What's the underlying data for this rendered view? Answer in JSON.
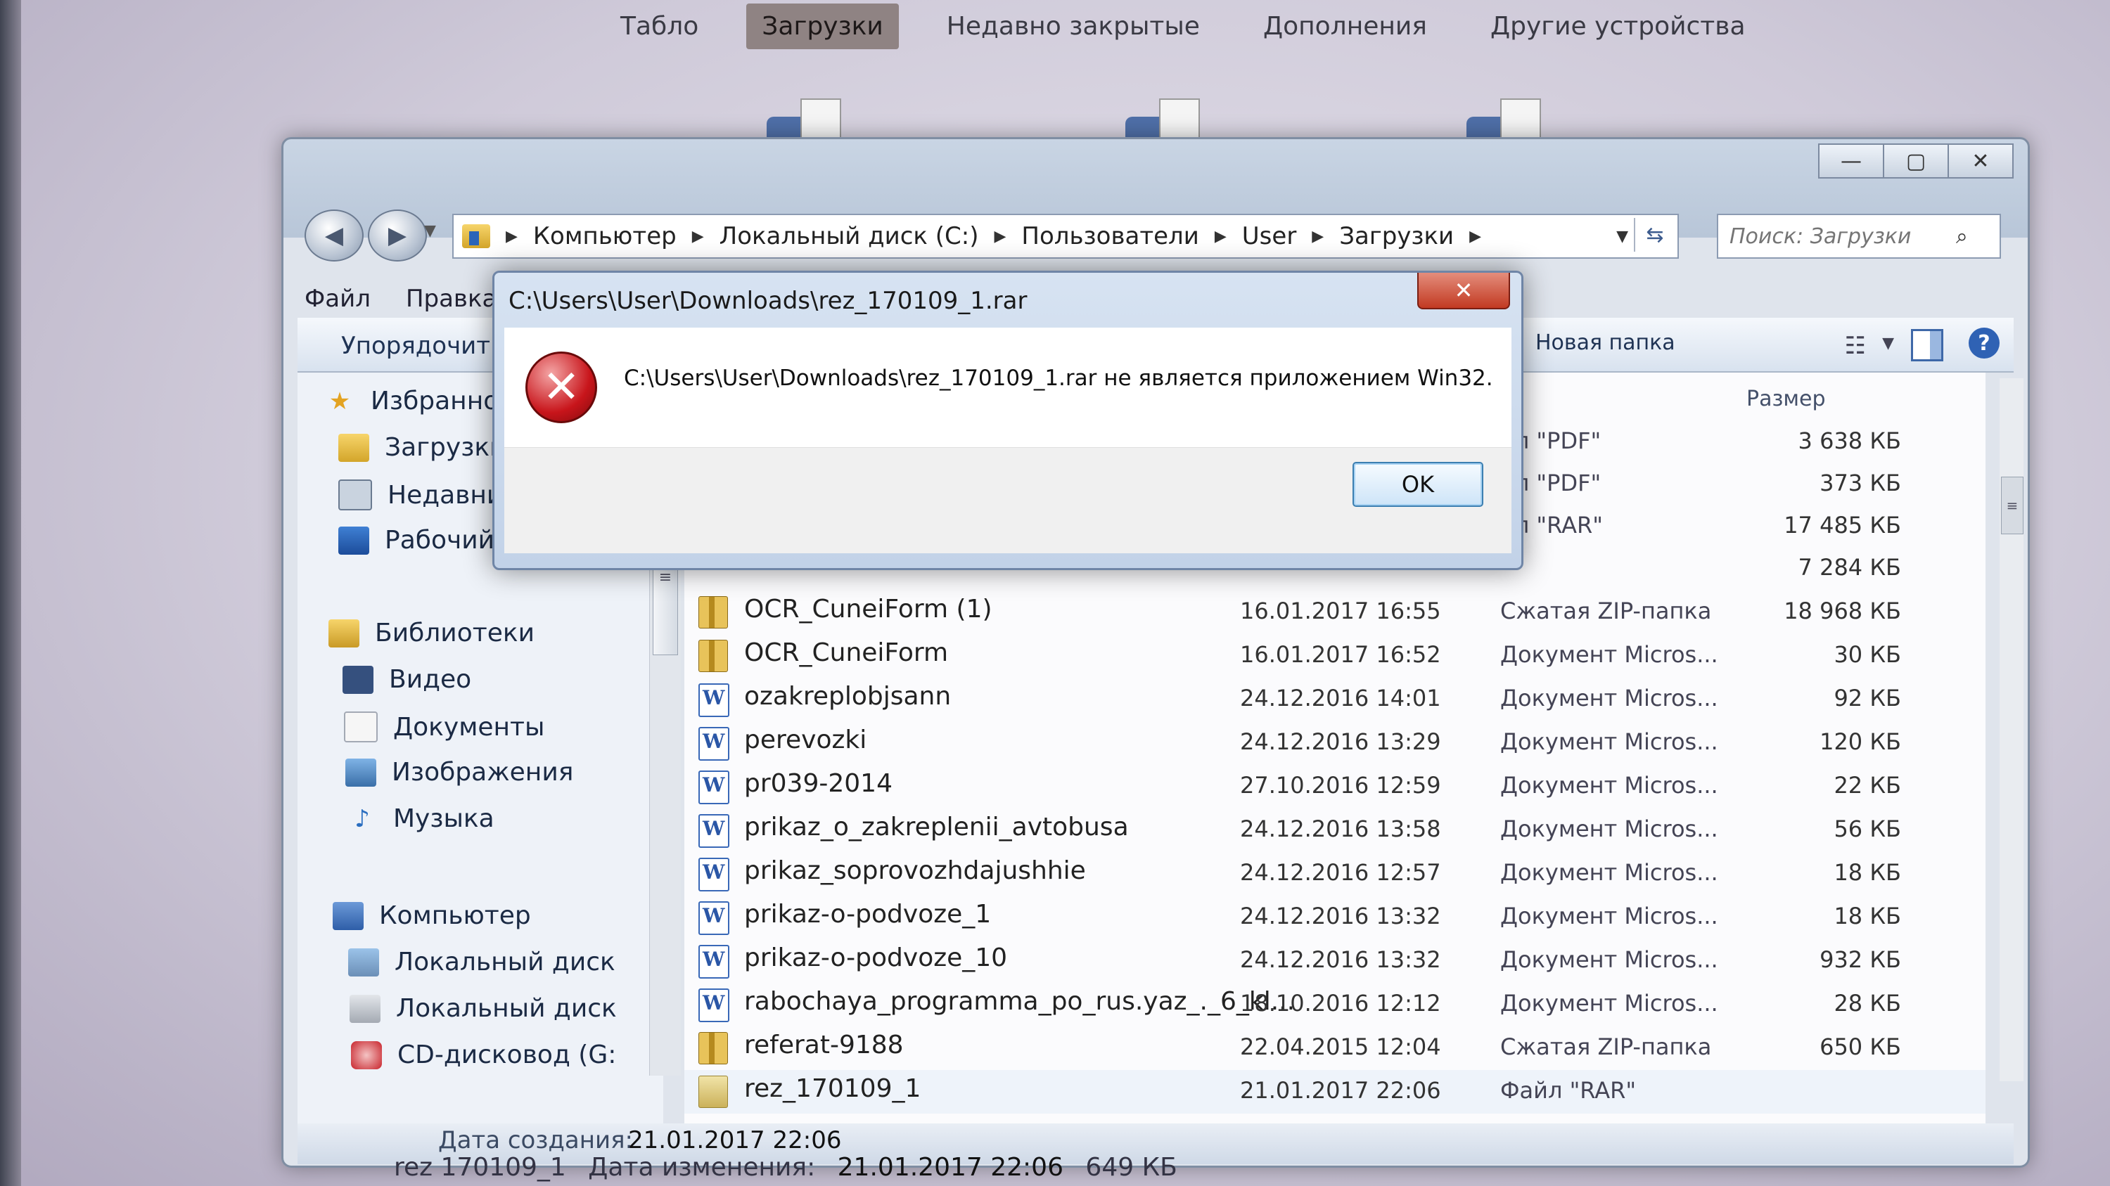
{
  "browser": {
    "tabs": [
      "Табло",
      "Загрузки",
      "Недавно закрытые",
      "Дополнения",
      "Другие устройства"
    ],
    "active_tab": 1
  },
  "explorer": {
    "window_controls": [
      "—",
      "▢",
      "✕"
    ],
    "address": {
      "crumbs": [
        "Компьютер",
        "Локальный диск (C:)",
        "Пользователи",
        "User",
        "Загрузки"
      ]
    },
    "search": {
      "placeholder": "Поиск: Загрузки"
    },
    "menu": [
      "Файл",
      "Правка"
    ],
    "toolbar": {
      "organize": "Упорядочить",
      "new_folder": "Новая папка"
    },
    "nav": [
      {
        "label": "Избранное",
        "icon": "star-icon",
        "level": 0
      },
      {
        "label": "Загрузки",
        "icon": "downloads-folder-icon",
        "level": 1
      },
      {
        "label": "Недавние места",
        "icon": "recent-places-icon",
        "level": 1
      },
      {
        "label": "Рабочий стол",
        "icon": "desktop-icon",
        "level": 1
      },
      {
        "label": "Библиотеки",
        "icon": "libraries-icon",
        "level": 0
      },
      {
        "label": "Видео",
        "icon": "video-icon",
        "level": 1
      },
      {
        "label": "Документы",
        "icon": "documents-icon",
        "level": 1
      },
      {
        "label": "Изображения",
        "icon": "pictures-icon",
        "level": 1
      },
      {
        "label": "Музыка",
        "icon": "music-icon",
        "level": 1
      },
      {
        "label": "Компьютер",
        "icon": "computer-icon",
        "level": 0
      },
      {
        "label": "Локальный диск",
        "icon": "local-disk-icon",
        "level": 1
      },
      {
        "label": "Локальный диск",
        "icon": "local-disk-icon",
        "level": 1
      },
      {
        "label": "CD-дисковод (G:",
        "icon": "cd-drive-icon",
        "level": 1
      }
    ],
    "columns": {
      "size": "Размер"
    },
    "hidden_rows": [
      {
        "type": "йл \"PDF\"",
        "size": "3 638 КБ"
      },
      {
        "type": "йл \"PDF\"",
        "size": "373 КБ"
      },
      {
        "type": "йл \"RAR\"",
        "size": "17 485 КБ"
      },
      {
        "type": "",
        "size": "7 284 КБ"
      }
    ],
    "files": [
      {
        "name": "OCR_CuneiForm (1)",
        "date": "16.01.2017 16:55",
        "type": "Сжатая ZIP-папка",
        "size": "18 968 КБ",
        "kind": "zip"
      },
      {
        "name": "OCR_CuneiForm",
        "date": "16.01.2017 16:52",
        "type": "Документ Micros...",
        "size": "30 КБ",
        "kind": "zip"
      },
      {
        "name": "ozakreplobjsann",
        "date": "24.12.2016 14:01",
        "type": "Документ Micros...",
        "size": "92 КБ",
        "kind": "doc"
      },
      {
        "name": "perevozki",
        "date": "24.12.2016 13:29",
        "type": "Документ Micros...",
        "size": "120 КБ",
        "kind": "doc"
      },
      {
        "name": "pr039-2014",
        "date": "27.10.2016 12:59",
        "type": "Документ Micros...",
        "size": "22 КБ",
        "kind": "doc"
      },
      {
        "name": "prikaz_o_zakreplenii_avtobusa",
        "date": "24.12.2016 13:58",
        "type": "Документ Micros...",
        "size": "56 КБ",
        "kind": "doc"
      },
      {
        "name": "prikaz_soprovozhdajushhie",
        "date": "24.12.2016 12:57",
        "type": "Документ Micros...",
        "size": "18 КБ",
        "kind": "doc"
      },
      {
        "name": "prikaz-o-podvoze_1",
        "date": "24.12.2016 13:32",
        "type": "Документ Micros...",
        "size": "18 КБ",
        "kind": "doc"
      },
      {
        "name": "prikaz-o-podvoze_10",
        "date": "24.12.2016 13:32",
        "type": "Документ Micros...",
        "size": "932 КБ",
        "kind": "doc"
      },
      {
        "name": "rabochaya_programma_po_rus.yaz_._6_kl...",
        "date": "18.10.2016 12:12",
        "type": "Документ Micros...",
        "size": "28 КБ",
        "kind": "doc"
      },
      {
        "name": "referat-9188",
        "date": "22.04.2015 12:04",
        "type": "Сжатая ZIP-папка",
        "size": "650 КБ",
        "kind": "zip"
      },
      {
        "name": "rez_170109_1",
        "date": "21.01.2017 22:06",
        "type": "Файл \"RAR\"",
        "size": "",
        "kind": "rar"
      }
    ],
    "details": {
      "filename": "rez 170109_1",
      "modified_label": "Дата изменения:",
      "modified": "21.01.2017 22:06",
      "created_label": "Дата создания:",
      "created": "21.01.2017 22:06",
      "size": "649 КБ"
    }
  },
  "dialog": {
    "title": "C:\\Users\\User\\Downloads\\rez_170109_1.rar",
    "message": "C:\\Users\\User\\Downloads\\rez_170109_1.rar не является приложением Win32.",
    "ok_label": "OK",
    "close_label": "✕",
    "icon": "error-icon"
  }
}
